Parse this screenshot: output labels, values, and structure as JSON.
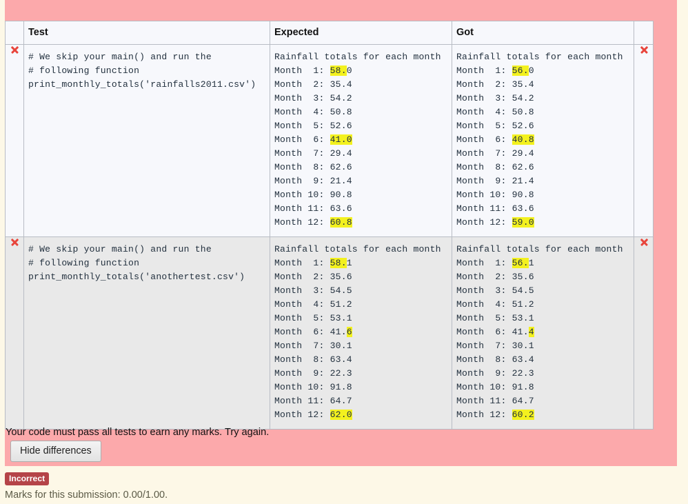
{
  "feedback": {
    "background_color": "#fca9ab",
    "message": "Your code must pass all tests to earn any marks. Try again.",
    "hide_differences_label": "Hide differences",
    "mark_icon_name": "cross-icon"
  },
  "table": {
    "headers": {
      "mark_left": "",
      "test": "Test",
      "expected": "Expected",
      "got": "Got",
      "mark_right": ""
    },
    "rows": [
      {
        "mark": "✗",
        "test_code": "# We skip your main() and run the\n# following function\nprint_monthly_totals('rainfalls2011.csv')",
        "expected_lines": [
          {
            "prefix": "Rainfall totals for each month",
            "highlight": "",
            "suffix": ""
          },
          {
            "prefix": "Month  1: ",
            "highlight": "58.",
            "suffix": "0"
          },
          {
            "prefix": "Month  2: 35.4",
            "highlight": "",
            "suffix": ""
          },
          {
            "prefix": "Month  3: 54.2",
            "highlight": "",
            "suffix": ""
          },
          {
            "prefix": "Month  4: 50.8",
            "highlight": "",
            "suffix": ""
          },
          {
            "prefix": "Month  5: 52.6",
            "highlight": "",
            "suffix": ""
          },
          {
            "prefix": "Month  6: ",
            "highlight": "41.0",
            "suffix": ""
          },
          {
            "prefix": "Month  7: 29.4",
            "highlight": "",
            "suffix": ""
          },
          {
            "prefix": "Month  8: 62.6",
            "highlight": "",
            "suffix": ""
          },
          {
            "prefix": "Month  9: 21.4",
            "highlight": "",
            "suffix": ""
          },
          {
            "prefix": "Month 10: 90.8",
            "highlight": "",
            "suffix": ""
          },
          {
            "prefix": "Month 11: 63.6",
            "highlight": "",
            "suffix": ""
          },
          {
            "prefix": "Month 12: ",
            "highlight": "60.8",
            "suffix": ""
          }
        ],
        "got_lines": [
          {
            "prefix": "Rainfall totals for each month",
            "highlight": "",
            "suffix": ""
          },
          {
            "prefix": "Month  1: ",
            "highlight": "56.",
            "suffix": "0"
          },
          {
            "prefix": "Month  2: 35.4",
            "highlight": "",
            "suffix": ""
          },
          {
            "prefix": "Month  3: 54.2",
            "highlight": "",
            "suffix": ""
          },
          {
            "prefix": "Month  4: 50.8",
            "highlight": "",
            "suffix": ""
          },
          {
            "prefix": "Month  5: 52.6",
            "highlight": "",
            "suffix": ""
          },
          {
            "prefix": "Month  6: ",
            "highlight": "40.8",
            "suffix": ""
          },
          {
            "prefix": "Month  7: 29.4",
            "highlight": "",
            "suffix": ""
          },
          {
            "prefix": "Month  8: 62.6",
            "highlight": "",
            "suffix": ""
          },
          {
            "prefix": "Month  9: 21.4",
            "highlight": "",
            "suffix": ""
          },
          {
            "prefix": "Month 10: 90.8",
            "highlight": "",
            "suffix": ""
          },
          {
            "prefix": "Month 11: 63.6",
            "highlight": "",
            "suffix": ""
          },
          {
            "prefix": "Month 12: ",
            "highlight": "59.0",
            "suffix": ""
          }
        ]
      },
      {
        "mark": "✗",
        "test_code": "# We skip your main() and run the\n# following function\nprint_monthly_totals('anothertest.csv')",
        "expected_lines": [
          {
            "prefix": "Rainfall totals for each month",
            "highlight": "",
            "suffix": ""
          },
          {
            "prefix": "Month  1: ",
            "highlight": "58.",
            "suffix": "1"
          },
          {
            "prefix": "Month  2: 35.6",
            "highlight": "",
            "suffix": ""
          },
          {
            "prefix": "Month  3: 54.5",
            "highlight": "",
            "suffix": ""
          },
          {
            "prefix": "Month  4: 51.2",
            "highlight": "",
            "suffix": ""
          },
          {
            "prefix": "Month  5: 53.1",
            "highlight": "",
            "suffix": ""
          },
          {
            "prefix": "Month  6: 41.",
            "highlight": "6",
            "suffix": ""
          },
          {
            "prefix": "Month  7: 30.1",
            "highlight": "",
            "suffix": ""
          },
          {
            "prefix": "Month  8: 63.4",
            "highlight": "",
            "suffix": ""
          },
          {
            "prefix": "Month  9: 22.3",
            "highlight": "",
            "suffix": ""
          },
          {
            "prefix": "Month 10: 91.8",
            "highlight": "",
            "suffix": ""
          },
          {
            "prefix": "Month 11: 64.7",
            "highlight": "",
            "suffix": ""
          },
          {
            "prefix": "Month 12: ",
            "highlight": "62.0",
            "suffix": ""
          }
        ],
        "got_lines": [
          {
            "prefix": "Rainfall totals for each month",
            "highlight": "",
            "suffix": ""
          },
          {
            "prefix": "Month  1: ",
            "highlight": "56.",
            "suffix": "1"
          },
          {
            "prefix": "Month  2: 35.6",
            "highlight": "",
            "suffix": ""
          },
          {
            "prefix": "Month  3: 54.5",
            "highlight": "",
            "suffix": ""
          },
          {
            "prefix": "Month  4: 51.2",
            "highlight": "",
            "suffix": ""
          },
          {
            "prefix": "Month  5: 53.1",
            "highlight": "",
            "suffix": ""
          },
          {
            "prefix": "Month  6: 41.",
            "highlight": "4",
            "suffix": ""
          },
          {
            "prefix": "Month  7: 30.1",
            "highlight": "",
            "suffix": ""
          },
          {
            "prefix": "Month  8: 63.4",
            "highlight": "",
            "suffix": ""
          },
          {
            "prefix": "Month  9: 22.3",
            "highlight": "",
            "suffix": ""
          },
          {
            "prefix": "Month 10: 91.8",
            "highlight": "",
            "suffix": ""
          },
          {
            "prefix": "Month 11: 64.7",
            "highlight": "",
            "suffix": ""
          },
          {
            "prefix": "Month 12: ",
            "highlight": "60.2",
            "suffix": ""
          }
        ]
      }
    ]
  },
  "grade": {
    "status_badge": "Incorrect",
    "marks_text": "Marks for this submission: 0.00/1.00.",
    "badge_color": "#b54448"
  }
}
